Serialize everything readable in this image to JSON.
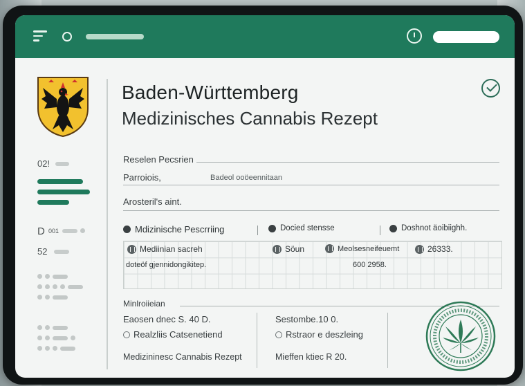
{
  "header": {
    "title": "Baden-Württemberg",
    "subtitle": "Medizinisches Cannabis Rezept"
  },
  "sidebar": {
    "label_1": "02!",
    "label_2": "D",
    "label_2b": "001",
    "label_3": "52"
  },
  "form": {
    "field_1": "Reselen Pecsrien",
    "field_2": "Parroiois,",
    "field_2_value": "Badeol ooöeennitaan",
    "field_3": "Arosteril's aint.",
    "section": {
      "item_1": "Mdizinische Pescrriing",
      "item_2": "Docied stensse",
      "item_3": "Doshnot äoibiighh."
    },
    "grid": {
      "col_1": "Mediinian sacreh",
      "col_2": "Söun",
      "col_3": "Meolsesneifeuemt",
      "col_4": "26333.",
      "row_1": "doteöf gjennidongikitep.",
      "row_2_value": "600 2958."
    },
    "lower": {
      "title": "Minlroiieian",
      "left_line": "Eaosen dnec S. 40 D.",
      "left_radio": "Realzliis Catsenetiend",
      "left_footer": "Medizininesc Cannabis Rezept",
      "right_line": "Sestombe.10 0.",
      "right_radio": "Rstraor e deszleing",
      "right_footer": "Mieffen ktiec R 20."
    }
  },
  "colors": {
    "accent": "#1f7a5c",
    "background": "#f3f5f4",
    "crest_gold": "#f2c12e",
    "crest_red": "#d0312d"
  },
  "icons": [
    "menu-icon",
    "circle-icon",
    "power-icon",
    "check-icon",
    "coat-of-arms-icon",
    "cannabis-stamp-icon"
  ]
}
